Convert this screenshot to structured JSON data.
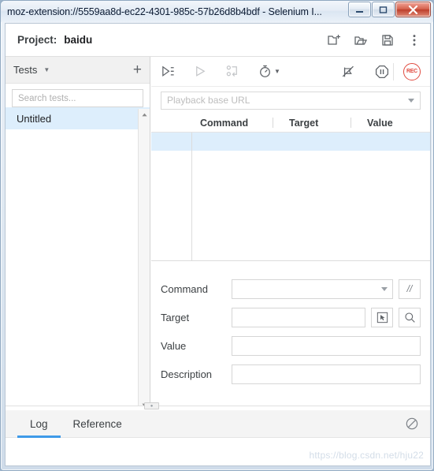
{
  "window": {
    "title": "moz-extension://5559aa8d-ec22-4301-985c-57b26d8b4bdf - Selenium I...",
    "controls": {
      "minimize": "minimize-icon",
      "maximize": "maximize-icon",
      "close": "close-icon"
    }
  },
  "project_header": {
    "label": "Project:",
    "name": "baidu",
    "actions": [
      {
        "name": "new-project-icon",
        "title": "New project"
      },
      {
        "name": "open-project-icon",
        "title": "Open project"
      },
      {
        "name": "save-project-icon",
        "title": "Save project"
      },
      {
        "name": "kebab-menu-icon",
        "title": "More options"
      }
    ]
  },
  "sidebar": {
    "title": "Tests",
    "caret": "chevron-down-icon",
    "add_label": "+",
    "search": {
      "placeholder": "Search tests...",
      "value": "",
      "icon": "search-icon"
    },
    "items": [
      {
        "label": "Untitled",
        "selected": true
      }
    ]
  },
  "toolbar": {
    "buttons": [
      {
        "name": "run-all-tests-icon",
        "label": "Run all tests",
        "disabled": false
      },
      {
        "name": "run-current-test-icon",
        "label": "Run current test",
        "disabled": true
      },
      {
        "name": "step-over-icon",
        "label": "Step over",
        "disabled": true
      },
      {
        "name": "test-speed-icon",
        "label": "Test execution speed",
        "disabled": false,
        "has_caret": true
      },
      {
        "name": "disable-breakpoints-icon",
        "label": "Disable breakpoints",
        "disabled": false
      },
      {
        "name": "pause-icon",
        "label": "Pause",
        "disabled": false
      },
      {
        "name": "record-button",
        "label": "REC",
        "disabled": false
      }
    ]
  },
  "base_url": {
    "placeholder": "Playback base URL",
    "value": "",
    "caret": "chevron-down-icon"
  },
  "table": {
    "columns": [
      "Command",
      "Target",
      "Value"
    ],
    "rows": [
      {
        "gutter": "",
        "command": "",
        "target": "",
        "value": "",
        "selected": true
      }
    ]
  },
  "command_form": {
    "fields": [
      {
        "label": "Command",
        "value": "",
        "type": "select"
      },
      {
        "label": "Target",
        "value": "",
        "type": "text"
      },
      {
        "label": "Value",
        "value": "",
        "type": "text"
      },
      {
        "label": "Description",
        "value": "",
        "type": "text"
      }
    ],
    "comment_button": "//",
    "select_target_icon": "select-target-icon",
    "find_target_icon": "find-target-icon"
  },
  "bottom_panel": {
    "tabs": [
      {
        "label": "Log",
        "active": true
      },
      {
        "label": "Reference",
        "active": false
      }
    ],
    "clear_icon": "clear-log-icon",
    "content": ""
  },
  "watermark": "https://blog.csdn.net/hju22",
  "colors": {
    "accent": "#3f9ae8",
    "selection": "#ddeefc",
    "record": "#e04a3f",
    "icon": "#5f6368"
  }
}
